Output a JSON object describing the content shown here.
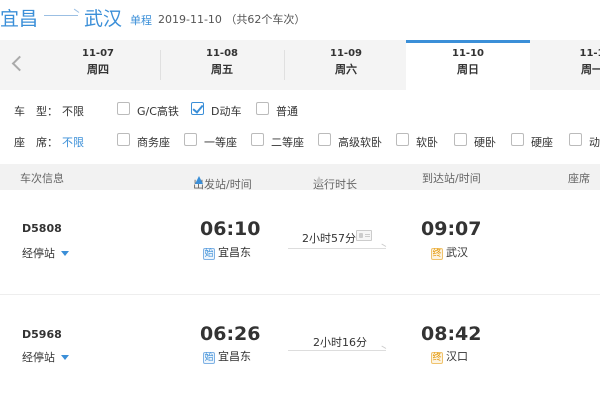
{
  "route": {
    "from": "宜昌",
    "to": "武汉",
    "trip_type": "单程",
    "summary": "2019-11-10 （共62个车次）"
  },
  "date_tabs": [
    {
      "date": "11-07",
      "weekday": "周四",
      "active": false
    },
    {
      "date": "11-08",
      "weekday": "周五",
      "active": false
    },
    {
      "date": "11-09",
      "weekday": "周六",
      "active": false
    },
    {
      "date": "11-10",
      "weekday": "周日",
      "active": true
    },
    {
      "date": "11-1",
      "weekday": "周一",
      "active": false
    }
  ],
  "filters": {
    "train_type": {
      "label": "车　型：",
      "all_label": "不限",
      "options": [
        {
          "label": "G/C高铁",
          "checked": false
        },
        {
          "label": "D动车",
          "checked": true
        },
        {
          "label": "普通",
          "checked": false
        }
      ]
    },
    "seat_type": {
      "label": "座　席：",
      "all_label": "不限",
      "options": [
        {
          "label": "商务座",
          "checked": false
        },
        {
          "label": "一等座",
          "checked": false
        },
        {
          "label": "二等座",
          "checked": false
        },
        {
          "label": "高级软卧",
          "checked": false
        },
        {
          "label": "软卧",
          "checked": false
        },
        {
          "label": "硬卧",
          "checked": false
        },
        {
          "label": "硬座",
          "checked": false
        },
        {
          "label": "动",
          "checked": false
        }
      ]
    }
  },
  "table_header": {
    "train_info": "车次信息",
    "depart": "出发站/时间",
    "duration": "运行时长",
    "arrive": "到达站/时间",
    "seats": "座席"
  },
  "trains": [
    {
      "number": "D5808",
      "stops_label": "经停站",
      "depart_time": "06:10",
      "depart_tag": "始",
      "depart_station": "宜昌东",
      "duration": "2小时57分",
      "arrive_time": "09:07",
      "arrive_tag": "终",
      "arrive_station": "武汉"
    },
    {
      "number": "D5968",
      "stops_label": "经停站",
      "depart_time": "06:26",
      "depart_tag": "始",
      "depart_station": "宜昌东",
      "duration": "2小时16分",
      "arrive_time": "08:42",
      "arrive_tag": "终",
      "arrive_station": "汉口"
    }
  ],
  "colors": {
    "accent": "#3b8fd8",
    "end_tag": "#e59b10"
  }
}
